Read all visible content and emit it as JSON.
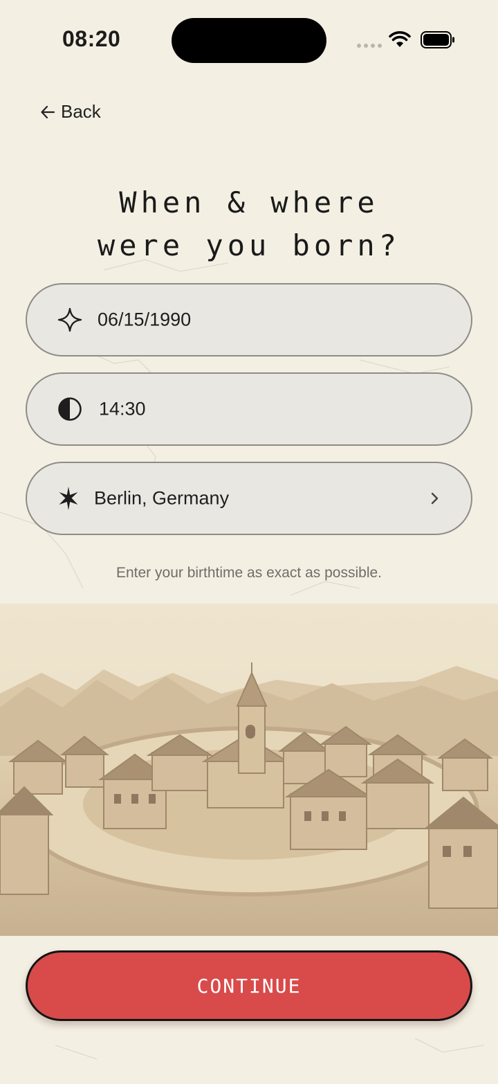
{
  "status_bar": {
    "time": "08:20"
  },
  "nav": {
    "back_label": "Back",
    "back_icon": "arrow-left-icon"
  },
  "title": "When & where\nwere you born?",
  "fields": {
    "birth_date": {
      "value": "06/15/1990",
      "icon": "sparkle-star-icon"
    },
    "birth_time": {
      "value": "14:30",
      "icon": "half-moon-icon"
    },
    "birth_place": {
      "value": "Berlin, Germany",
      "icon": "six-point-star-icon",
      "trailing_icon": "chevron-right-icon"
    }
  },
  "hint": "Enter your birthtime as exact as possible.",
  "illustration": {
    "description_icon": "clay-village-illustration"
  },
  "primary_action": {
    "label": "CONTINUE"
  },
  "colors": {
    "background": "#f3efe3",
    "field_bg": "#e9e7e1",
    "accent": "#d94a4a"
  }
}
